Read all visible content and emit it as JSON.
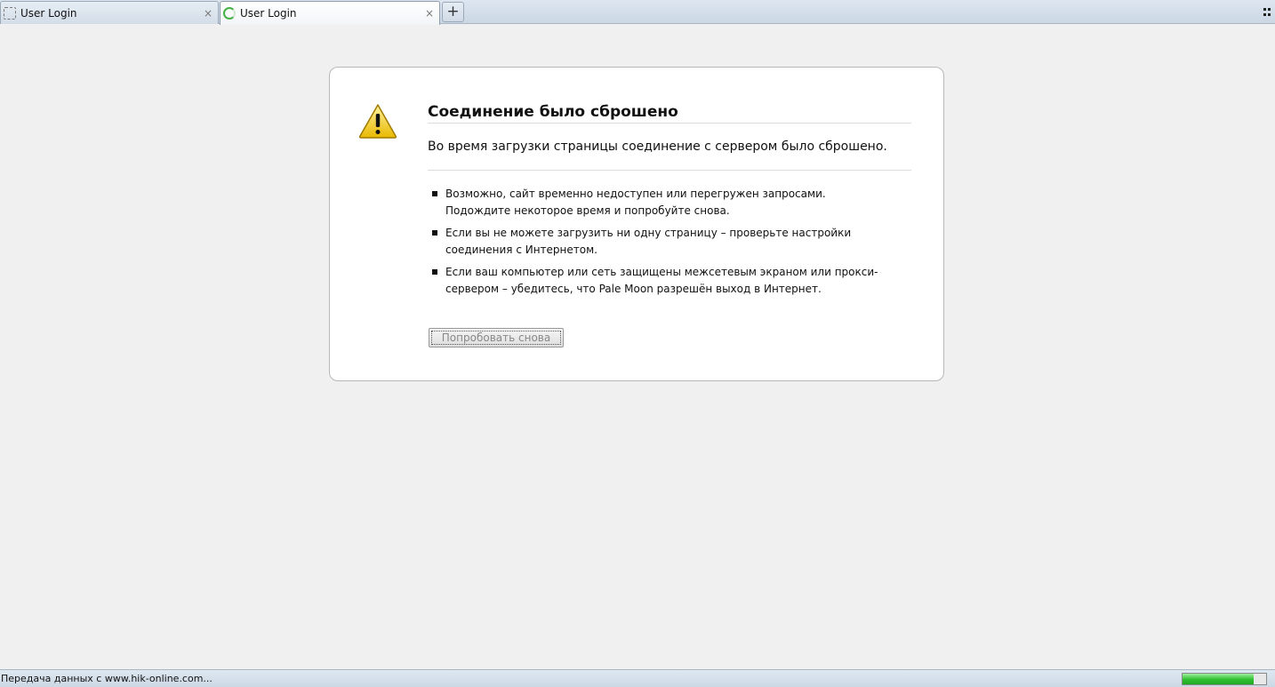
{
  "tabs": [
    {
      "label": "User Login",
      "state": "inactive",
      "icon": "blank-page-icon"
    },
    {
      "label": "User Login",
      "state": "active-loading",
      "icon": "loading-spinner-icon"
    }
  ],
  "tabbar": {
    "new_tab": "+",
    "close": "×"
  },
  "error": {
    "title": "Соединение было сброшено",
    "description": "Во время загрузки страницы соединение с сервером было сброшено.",
    "tips": [
      "Возможно, сайт временно недоступен или перегружен запросами. Подождите некоторое время и попробуйте снова.",
      "Если вы не можете загрузить ни одну страницу – проверьте настройки соединения с Интернетом.",
      "Если ваш компьютер или сеть защищены межсетевым экраном или прокси-сервером – убедитесь, что Pale Moon разрешён выход в Интернет."
    ],
    "retry_label": "Попробовать снова",
    "icon": "warning-icon"
  },
  "status": {
    "text": "Передача данных с www.hik-online.com...",
    "progress": 0.85
  },
  "colors": {
    "progress_fill": "#2fbf2f",
    "warning_yellow": "#f2cc1f",
    "loading_green": "#45b045"
  }
}
